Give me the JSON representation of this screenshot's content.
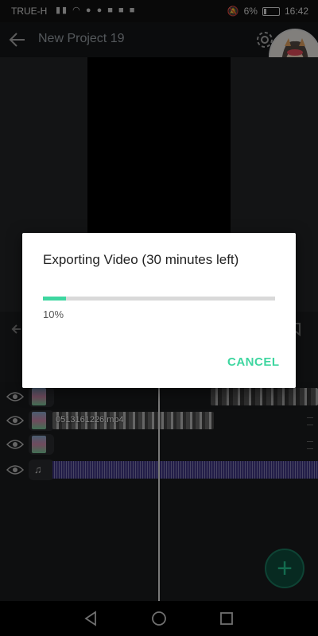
{
  "status_bar": {
    "carrier": "TRUE-H",
    "battery": "6%",
    "time": "16:42",
    "icon_names": [
      "signal-icon",
      "wifi-icon",
      "messenger-icon",
      "chat-icon",
      "facebook-icon",
      "mail-icon",
      "notification-icon",
      "mute-icon",
      "battery-icon"
    ]
  },
  "app_bar": {
    "title": "New Project 19"
  },
  "timeline": {
    "clip_label": "0513161226.mp4"
  },
  "dialog": {
    "title": "Exporting Video (30 minutes left)",
    "progress_percent": 10,
    "progress_text": "10%",
    "cancel_label": "CANCEL"
  },
  "colors": {
    "accent": "#3ed6a0",
    "audio_track": "#3f3584",
    "background": "#1c1e20"
  }
}
